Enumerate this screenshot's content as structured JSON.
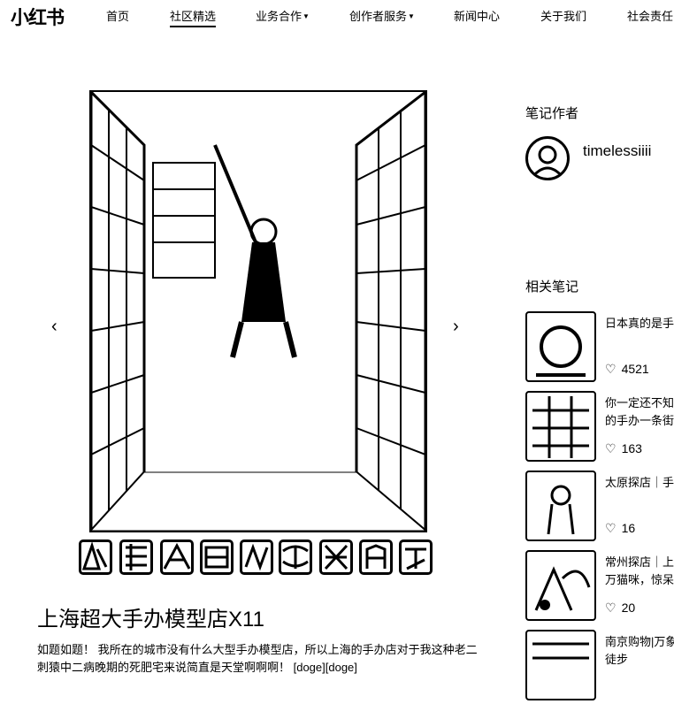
{
  "nav": {
    "logo": "小红书",
    "items": [
      {
        "label": "首页"
      },
      {
        "label": "社区精选"
      },
      {
        "label": "业务合作"
      },
      {
        "label": "创作者服务"
      },
      {
        "label": "新闻中心"
      },
      {
        "label": "关于我们"
      },
      {
        "label": "社会责任"
      }
    ]
  },
  "note": {
    "title": "上海超大手办模型店X11",
    "description": "如题如题！ 我所在的城市没有什么大型手办模型店，所以上海的手办店对于我这种老二刺猿中二病晚期的死肥宅来说简直是天堂啊啊啊！ [doge][doge]"
  },
  "author": {
    "section_label": "笔记作者",
    "name": "timelessiiii"
  },
  "related": {
    "section_label": "相关笔记",
    "items": [
      {
        "title": "日本真的是手",
        "likes": "4521"
      },
      {
        "title": "你一定还不知\n的手办一条街",
        "likes": "163"
      },
      {
        "title": "太原探店｜手",
        "likes": "16"
      },
      {
        "title": "常州探店｜上\n万猫咪，惊呆",
        "likes": "20"
      },
      {
        "title": "南京购物|万象\n徒步",
        "likes": ""
      }
    ]
  },
  "icons": {
    "prev": "chevron-left-icon",
    "next": "chevron-right-icon",
    "like": "heart-icon",
    "dropdown": "caret-down-icon"
  }
}
